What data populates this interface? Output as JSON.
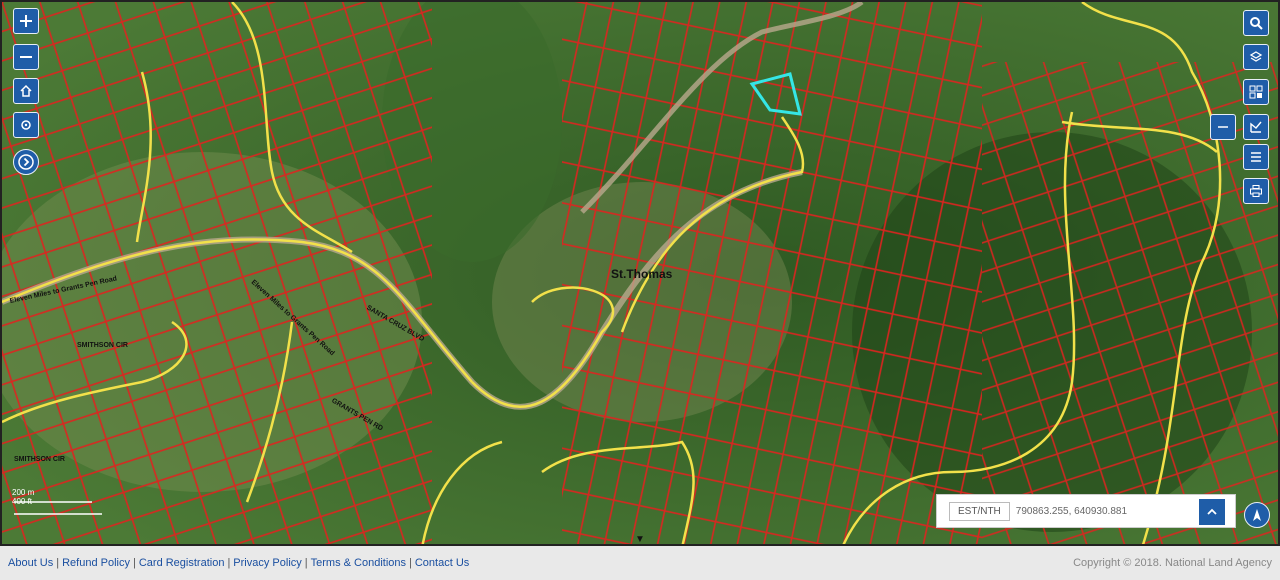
{
  "map": {
    "place_label": "St.Thomas",
    "road_labels": {
      "r1": "Eleven Miles to Grants Pen Road",
      "r2": "Eleven Miles to Grants Pen Road",
      "r3": "SANTA CRUZ BLVD",
      "r4": "SMITHSON CIR",
      "r5": "GRANTS PEN RD",
      "r6": "SMITHSON CIR"
    },
    "scale_top": "200 m",
    "scale_bottom": "400 ft"
  },
  "tools_left": [
    "zoom-in-icon",
    "zoom-out-icon",
    "home-icon",
    "locate-icon",
    "expand-icon"
  ],
  "tools_right": [
    "search-icon",
    "layers-icon",
    "basemap-icon",
    "measure-icon",
    "list-icon",
    "print-icon"
  ],
  "coords": {
    "label": "EST/NTH",
    "value": "790863.255, 640930.881"
  },
  "footer": {
    "links": [
      "About Us",
      "Refund Policy",
      "Card Registration",
      "Privacy Policy",
      "Terms & Conditions",
      "Contact Us"
    ],
    "copyright": "Copyright © 2018. National Land Agency"
  },
  "colors": {
    "parcel": "#e0231f",
    "road": "#f2e14a",
    "highlight": "#35e6e6",
    "button": "#1f5da8"
  }
}
